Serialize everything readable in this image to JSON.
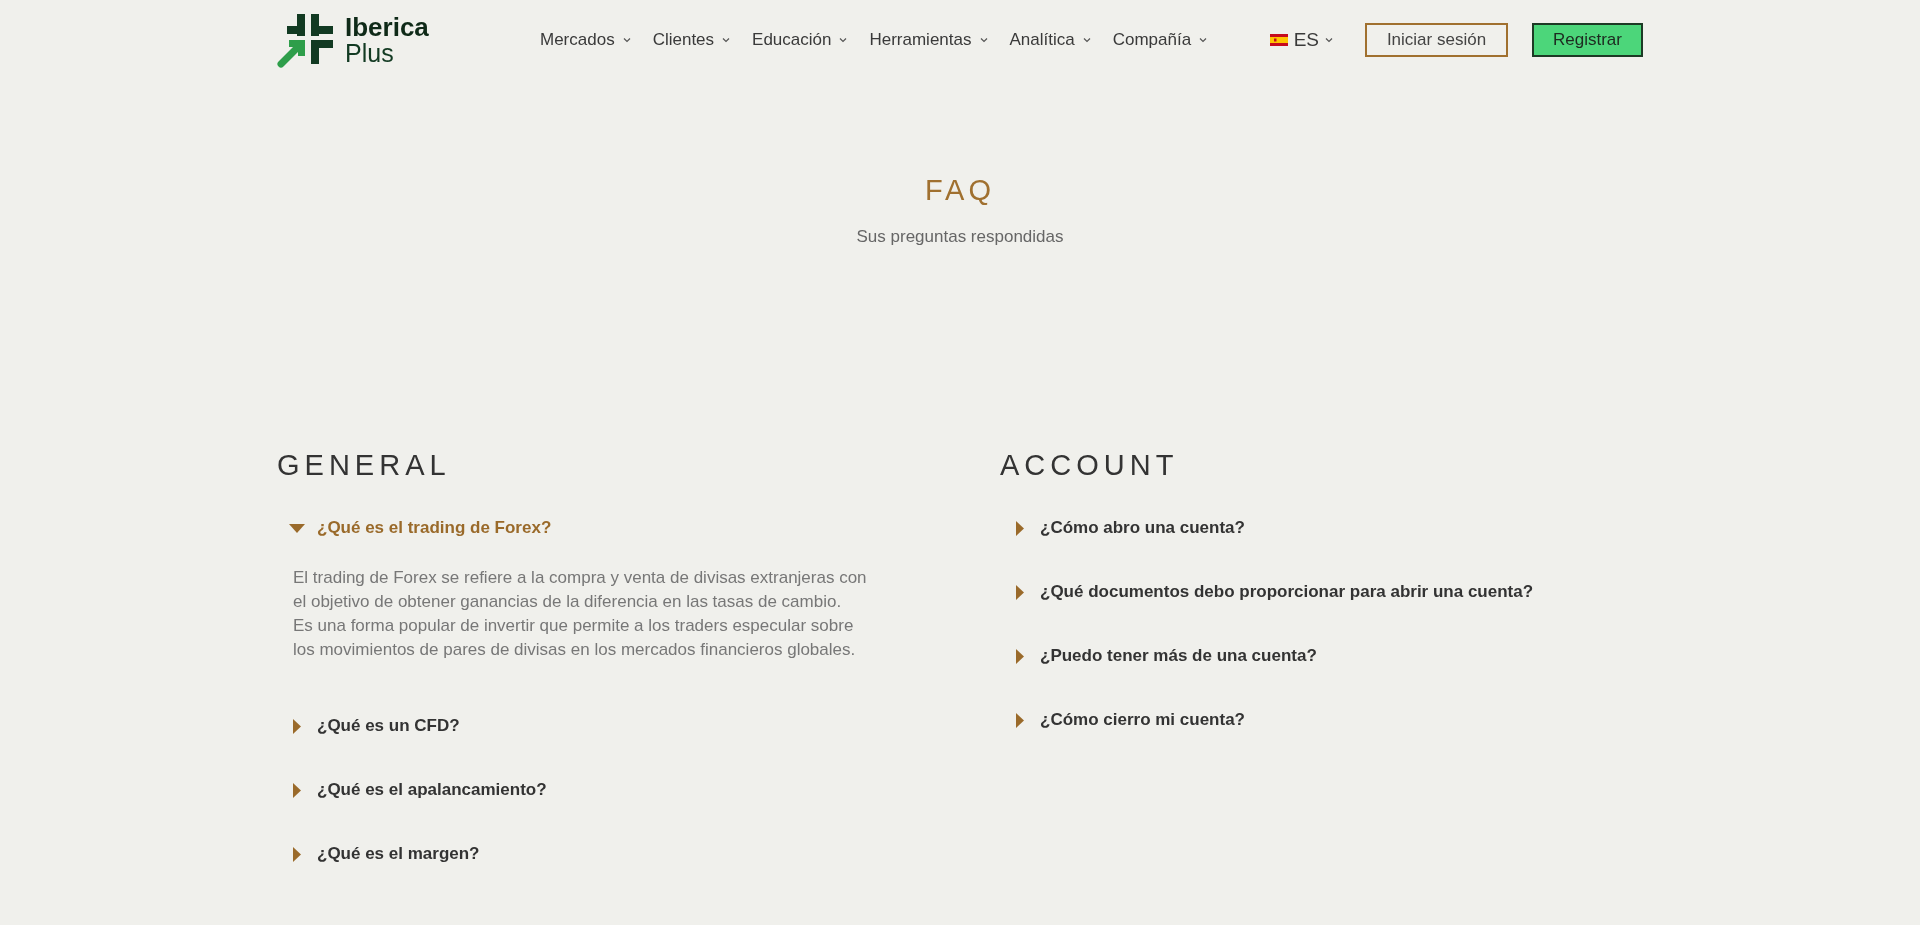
{
  "header": {
    "logo": {
      "line1": "Iberica",
      "line2": "Plus"
    },
    "nav": [
      {
        "label": "Mercados"
      },
      {
        "label": "Clientes"
      },
      {
        "label": "Educación"
      },
      {
        "label": "Herramientas"
      },
      {
        "label": "Analítica"
      },
      {
        "label": "Compañía"
      }
    ],
    "language": "ES",
    "login": "Iniciar sesión",
    "register": "Registrar"
  },
  "hero": {
    "title": "FAQ",
    "subtitle": "Sus preguntas respondidas"
  },
  "sections": [
    {
      "heading": "GENERAL",
      "items": [
        {
          "question": "¿Qué es el trading de Forex?",
          "expanded": true,
          "answer": [
            "El trading de Forex se refiere a la compra y venta de divisas extranjeras con el objetivo de obtener ganancias de la diferencia en las tasas de cambio.",
            "Es una forma popular de invertir que permite a los traders especular sobre los movimientos de pares de divisas en los mercados financieros globales."
          ]
        },
        {
          "question": "¿Qué es un CFD?",
          "expanded": false
        },
        {
          "question": "¿Qué es el apalancamiento?",
          "expanded": false
        },
        {
          "question": "¿Qué es el margen?",
          "expanded": false
        }
      ]
    },
    {
      "heading": "ACCOUNT",
      "items": [
        {
          "question": "¿Cómo abro una cuenta?",
          "expanded": false
        },
        {
          "question": "¿Qué documentos debo proporcionar para abrir una cuenta?",
          "expanded": false
        },
        {
          "question": "¿Puedo tener más de una cuenta?",
          "expanded": false
        },
        {
          "question": "¿Cómo cierro mi cuenta?",
          "expanded": false
        }
      ]
    }
  ]
}
